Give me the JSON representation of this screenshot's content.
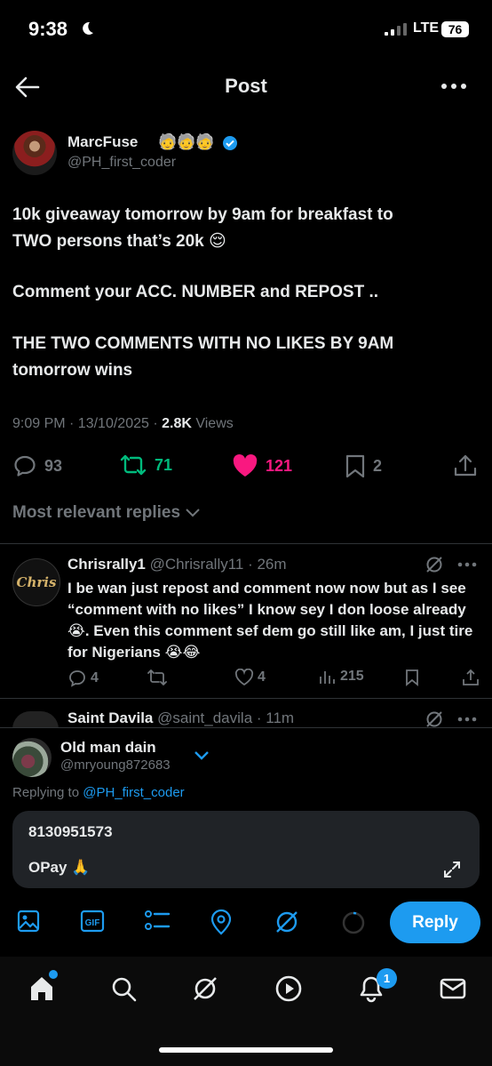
{
  "status_bar": {
    "time": "9:38",
    "network": "LTE",
    "battery": "76"
  },
  "header": {
    "title": "Post"
  },
  "post": {
    "author_name": "MarcFuse",
    "author_emoji": "🧓🧓🧓",
    "author_handle": "@PH_first_coder",
    "lines": [
      "10k giveaway tomorrow by 9am for breakfast to",
      "TWO persons that’s 20k 😌",
      "Comment your ACC. NUMBER and REPOST ..",
      "THE  TWO COMMENTS WITH NO LIKES BY 9AM",
      "tomorrow wins"
    ],
    "timestamp": "9:09 PM · 13/10/2025 · ",
    "views_count": "2.8K",
    "views_label": " Views",
    "replies": "93",
    "reposts": "71",
    "likes": "121",
    "bookmarks": "2"
  },
  "replies_filter": "Most relevant replies",
  "reply1": {
    "name": "Chrisrally1",
    "handle": "@Chrisrally11 · 26m",
    "text": "I be wan just repost and comment now now but as I see “comment with no likes” I know sey I don loose already 😭. Even this comment sef dem go still like am, I just tire for Nigerians 😭😂",
    "replies": "4",
    "likes": "4",
    "views": "215",
    "avatar_text": "Chris"
  },
  "reply2": {
    "name": "Saint Davila",
    "handle": "@saint_davila · 11m"
  },
  "composer": {
    "name": "Old man dain",
    "handle": "@mryoung872683",
    "replying_label": "Replying to ",
    "replying_handle": "@PH_first_coder",
    "line1": "8130951573",
    "line2": "OPay 🙏",
    "gif_label": "GIF",
    "reply_button": "Reply"
  },
  "nav": {
    "notifications_count": "1"
  },
  "colors": {
    "accent": "#1d9bf0",
    "repost": "#00ba7c",
    "like": "#f91880",
    "muted": "#71767b"
  }
}
